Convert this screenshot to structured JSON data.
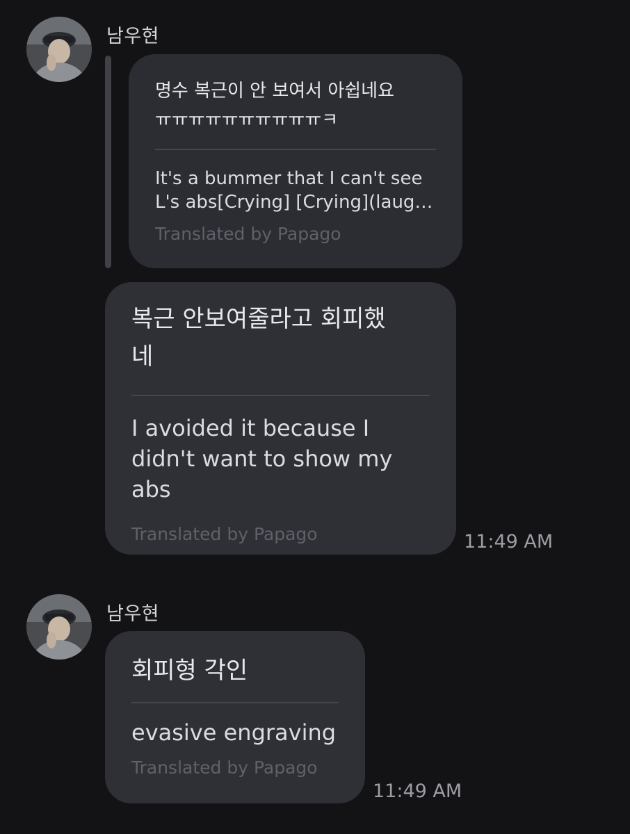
{
  "messages": [
    {
      "sender": "남우현",
      "quoted": {
        "original_lines": [
          "명수 복근이 안 보여서 아쉽네요",
          "ㅠㅠㅠㅠㅠㅠㅠㅠㅠㅠㅋ"
        ],
        "translation_lines": [
          "It's a bummer that I can't see",
          "L's abs[Crying] [Crying](laug…"
        ],
        "translated_by": "Translated by Papago"
      },
      "original_lines": [
        "복근 안보여줄라고 회피했",
        "네"
      ],
      "translation_lines": [
        "I avoided it because I",
        "didn't want to show my",
        "abs"
      ],
      "translated_by": "Translated by Papago",
      "time": "11:49 AM"
    },
    {
      "sender": "남우현",
      "original_lines": [
        "회피형 각인"
      ],
      "translation_lines": [
        "evasive engraving"
      ],
      "translated_by": "Translated by Papago",
      "time": "11:49 AM"
    }
  ]
}
